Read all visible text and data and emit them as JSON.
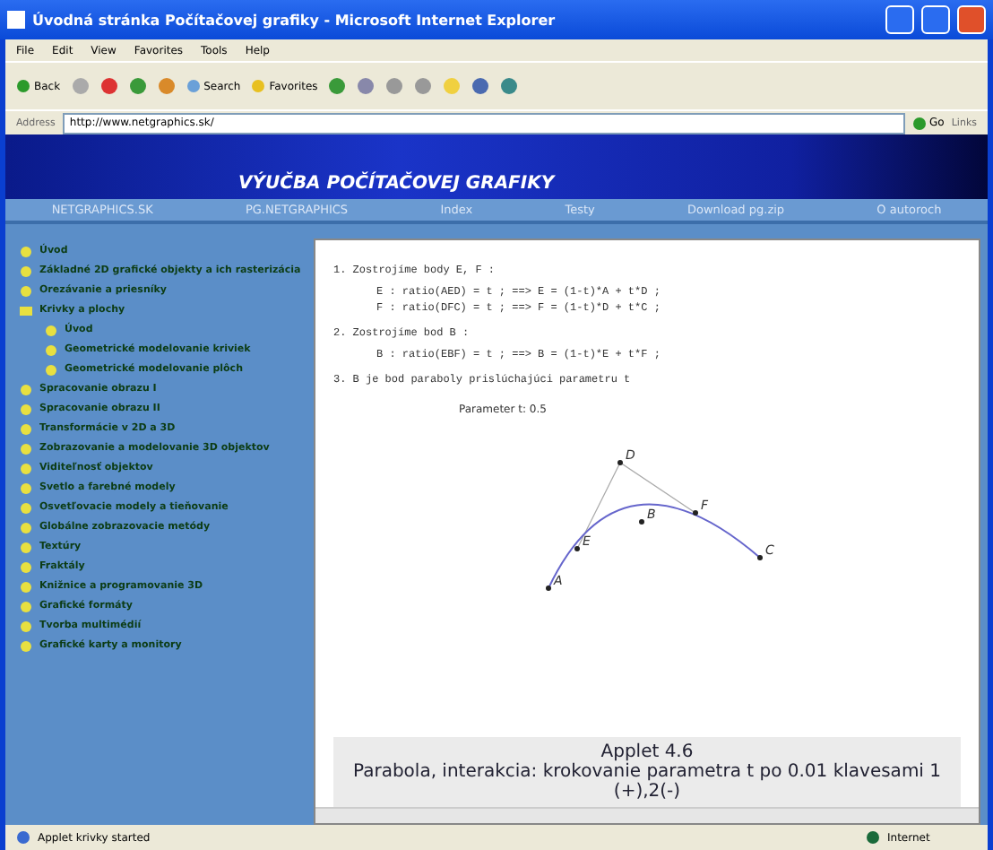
{
  "window": {
    "title": "Úvodná stránka Počítačovej grafiky - Microsoft Internet Explorer"
  },
  "menu": [
    "File",
    "Edit",
    "View",
    "Favorites",
    "Tools",
    "Help"
  ],
  "toolbar": [
    {
      "kind": "back",
      "label": "Back"
    },
    {
      "kind": "forward"
    },
    {
      "kind": "stop"
    },
    {
      "kind": "refresh"
    },
    {
      "kind": "home"
    },
    {
      "kind": "search",
      "label": "Search"
    },
    {
      "kind": "favorites",
      "label": "Favorites"
    },
    {
      "kind": "history"
    },
    {
      "kind": "mail"
    },
    {
      "kind": "print"
    },
    {
      "kind": "edit"
    },
    {
      "kind": "folder"
    },
    {
      "kind": "messenger"
    },
    {
      "kind": "tool"
    }
  ],
  "address_bar": {
    "label": "Address",
    "value": "http://www.netgraphics.sk/",
    "go": "Go",
    "links": "Links"
  },
  "banner": {
    "title": "VÝUČBA POČÍTAČOVEJ GRAFIKY"
  },
  "nav": [
    "NETGRAPHICS.SK",
    "PG.NETGRAPHICS",
    "Index",
    "Testy",
    "Download pg.zip",
    "O autoroch"
  ],
  "sidebar": {
    "items": [
      {
        "label": "Úvod",
        "expanded": false
      },
      {
        "label": "Základné 2D grafické objekty a ich rasterizácia",
        "expanded": false
      },
      {
        "label": "Orezávanie a priesníky",
        "expanded": false
      },
      {
        "label": "Krivky a plochy",
        "expanded": true,
        "children": [
          {
            "label": "Úvod"
          },
          {
            "label": "Geometrické modelovanie kriviek"
          },
          {
            "label": "Geometrické modelovanie plôch"
          }
        ]
      },
      {
        "label": "Spracovanie obrazu I",
        "expanded": false
      },
      {
        "label": "Spracovanie obrazu II",
        "expanded": false
      },
      {
        "label": "Transformácie v 2D a 3D",
        "expanded": false
      },
      {
        "label": "Zobrazovanie a modelovanie 3D objektov",
        "expanded": false
      },
      {
        "label": "Viditeľnosť objektov",
        "expanded": false
      },
      {
        "label": "Svetlo a farebné modely",
        "expanded": false
      },
      {
        "label": "Osvetľovacie modely a tieňovanie",
        "expanded": false
      },
      {
        "label": "Globálne zobrazovacie metódy",
        "expanded": false
      },
      {
        "label": "Textúry",
        "expanded": false
      },
      {
        "label": "Fraktály",
        "expanded": false
      },
      {
        "label": "Knižnice a programovanie 3D",
        "expanded": false
      },
      {
        "label": "Grafické formáty",
        "expanded": false
      },
      {
        "label": "Tvorba multimédií",
        "expanded": false
      },
      {
        "label": "Grafické karty a monitory",
        "expanded": false
      }
    ]
  },
  "content": {
    "lines": [
      {
        "kind": "step",
        "text": "1. Zostrojíme body E, F :"
      },
      {
        "kind": "formula",
        "text": "E : ratio(AED) = t ; ==> E = (1-t)*A + t*D ;"
      },
      {
        "kind": "formula",
        "text": "F : ratio(DFC) = t ; ==> F = (1-t)*D + t*C ;"
      },
      {
        "kind": "step",
        "text": "2. Zostrojíme bod B :"
      },
      {
        "kind": "formula",
        "text": "B : ratio(EBF) = t ; ==> B = (1-t)*E + t*F ;"
      },
      {
        "kind": "step",
        "text": "3. B je bod paraboly prislúchajúci parametru t"
      }
    ],
    "applet": {
      "parameter": "Parameter t: 0.5",
      "points": [
        "A",
        "B",
        "C",
        "D",
        "E",
        "F"
      ]
    },
    "caption": {
      "title": "Applet 4.6",
      "text": "Parabola, interakcia: krokovanie parametra t po 0.01 klavesami 1 (+),2(-)"
    }
  },
  "status_bar": {
    "text": "Applet krivky started",
    "zone": "Internet"
  }
}
